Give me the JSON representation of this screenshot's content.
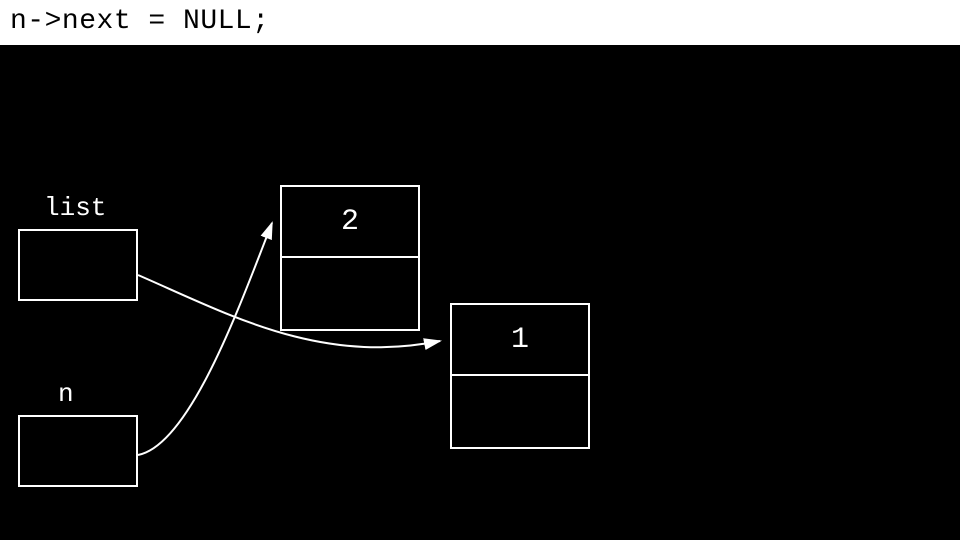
{
  "code_line": "n->next = NULL;",
  "labels": {
    "list": "list",
    "n": "n"
  },
  "nodes": {
    "node2": {
      "value": "2"
    },
    "node1": {
      "value": "1"
    }
  }
}
